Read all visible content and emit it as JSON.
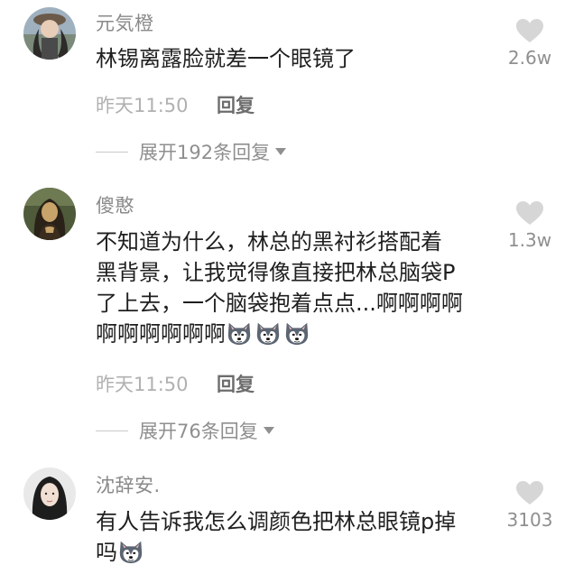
{
  "comments": [
    {
      "username": "元気橙",
      "text": "林锡离露脸就差一个眼镜了",
      "time": "昨天11:50",
      "reply_label": "回复",
      "expand_label": "展开192条回复",
      "likes": "2.6w",
      "avatar": "avatar-girl-hat"
    },
    {
      "username": "傻憨",
      "text_lines": [
        "不知道为什么，林总的黑衬衫搭配着",
        "黑背景，让我觉得像直接把林总脑袋P",
        "了上去，一个脑袋抱着点点...啊啊啊啊",
        "啊啊啊啊啊啊"
      ],
      "emoji": [
        "husky-emoji",
        "husky-emoji",
        "husky-emoji"
      ],
      "time": "昨天11:50",
      "reply_label": "回复",
      "expand_label": "展开76条回复",
      "likes": "1.3w",
      "avatar": "avatar-mona-lisa"
    },
    {
      "username": "沈辞安.",
      "text_lines": [
        "有人告诉我怎么调颜色把林总眼镜p掉",
        "吗"
      ],
      "emoji": [
        "husky-emoji"
      ],
      "likes": "3103",
      "avatar": "avatar-girl-portrait"
    }
  ],
  "colors": {
    "heart": "#d6d6d6",
    "username": "#8a8a8a",
    "time": "#b1b1b1"
  }
}
